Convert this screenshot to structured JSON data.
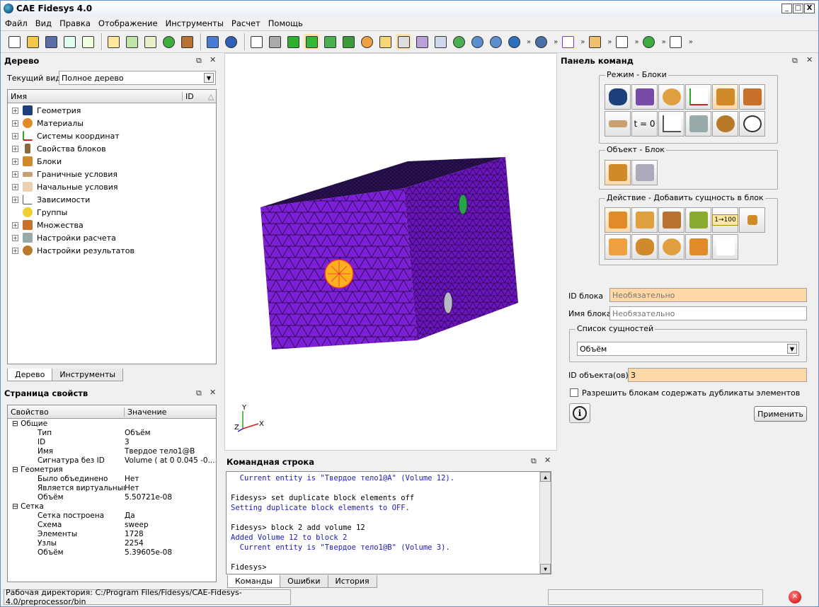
{
  "app": {
    "title": "CAE Fidesys 4.0"
  },
  "window_controls": {
    "min": "_",
    "max": "□",
    "close": "X"
  },
  "menu": [
    "Файл",
    "Вид",
    "Правка",
    "Отображение",
    "Инструменты",
    "Расчет",
    "Помощь"
  ],
  "toolbar": {
    "overflow": "»"
  },
  "tree_panel": {
    "title": "Дерево",
    "view_label": "Текущий вид",
    "view_value": "Полное дерево",
    "col_name": "Имя",
    "col_id": "ID",
    "items": [
      "Геометрия",
      "Материалы",
      "Системы координат",
      "Свойства блоков",
      "Блоки",
      "Граничные условия",
      "Начальные условия",
      "Зависимости",
      "Группы",
      "Множества",
      "Настройки расчета",
      "Настройки результатов"
    ]
  },
  "tree_tabs": [
    "Дерево",
    "Инструменты"
  ],
  "props_panel": {
    "title": "Страница свойств",
    "col_prop": "Свойство",
    "col_val": "Значение",
    "rows": [
      {
        "p": "Общие",
        "v": "",
        "lvl": 0,
        "exp": true
      },
      {
        "p": "Тип",
        "v": "Объём",
        "lvl": 1
      },
      {
        "p": "ID",
        "v": "3",
        "lvl": 1
      },
      {
        "p": "Имя",
        "v": "Твердое тело1@B",
        "lvl": 1
      },
      {
        "p": "Сигнатура без ID",
        "v": "Volume ( at 0 0.045 -0....",
        "lvl": 1
      },
      {
        "p": "Геометрия",
        "v": "",
        "lvl": 0,
        "exp": true
      },
      {
        "p": "Было объединено",
        "v": "Нет",
        "lvl": 1
      },
      {
        "p": "Является виртуальным",
        "v": "Нет",
        "lvl": 1
      },
      {
        "p": "Объём",
        "v": "5.50721e-08",
        "lvl": 1
      },
      {
        "p": "Сетка",
        "v": "",
        "lvl": 0,
        "exp": true
      },
      {
        "p": "Сетка построена",
        "v": "Да",
        "lvl": 1
      },
      {
        "p": "Схема",
        "v": "sweep",
        "lvl": 1
      },
      {
        "p": "Элементы",
        "v": "1728",
        "lvl": 1
      },
      {
        "p": "Узлы",
        "v": "2254",
        "lvl": 1
      },
      {
        "p": "Объём",
        "v": "5.39605e-08",
        "lvl": 1
      }
    ]
  },
  "axes": {
    "y": "Y",
    "x": "X",
    "z": "Z"
  },
  "cmdline": {
    "title": "Командная строка",
    "lines": [
      {
        "t": "  Current entity is \"Твердое тело1@A\" (Volume 12).",
        "c": "blu"
      },
      {
        "t": " ",
        "c": "blk"
      },
      {
        "t": "Fidesys> set duplicate block elements off",
        "c": "blk"
      },
      {
        "t": "Setting duplicate block elements to OFF.",
        "c": "blu"
      },
      {
        "t": " ",
        "c": "blk"
      },
      {
        "t": "Fidesys> block 2 add volume 12",
        "c": "blk"
      },
      {
        "t": "Added Volume 12 to block 2",
        "c": "blu"
      },
      {
        "t": "  Current entity is \"Твердое тело1@B\" (Volume 3).",
        "c": "blu"
      },
      {
        "t": " ",
        "c": "blk"
      },
      {
        "t": "Fidesys>",
        "c": "blk"
      }
    ],
    "tabs": [
      "Команды",
      "Ошибки",
      "История"
    ]
  },
  "command_panel": {
    "title": "Панель команд",
    "mode_label": "Режим - Блоки",
    "object_label": "Объект - Блок",
    "action_label": "Действие - Добавить сущность в блок",
    "mode_t0": "t = 0",
    "action_100": "1→100",
    "block_id_label": "ID блока",
    "block_id_placeholder": "Необязательно",
    "block_name_label": "Имя блока",
    "block_name_placeholder": "Необязательно",
    "entities_label": "Список сущностей",
    "entities_value": "Объём",
    "object_ids_label": "ID объекта(ов)",
    "object_ids_value": "3",
    "allow_dup_label": "Разрешить блокам содержать дубликаты элементов",
    "apply_label": "Применить",
    "info_glyph": "i"
  },
  "status": {
    "workdir": "Рабочая директория: C:/Program Files/Fidesys/CAE-Fidesys-4.0/preprocessor/bin"
  },
  "colors": {
    "mesh": "#7d1fd6",
    "top": "#1d0f3a",
    "hole": "#ffb020",
    "active": "#ffd8a8"
  }
}
